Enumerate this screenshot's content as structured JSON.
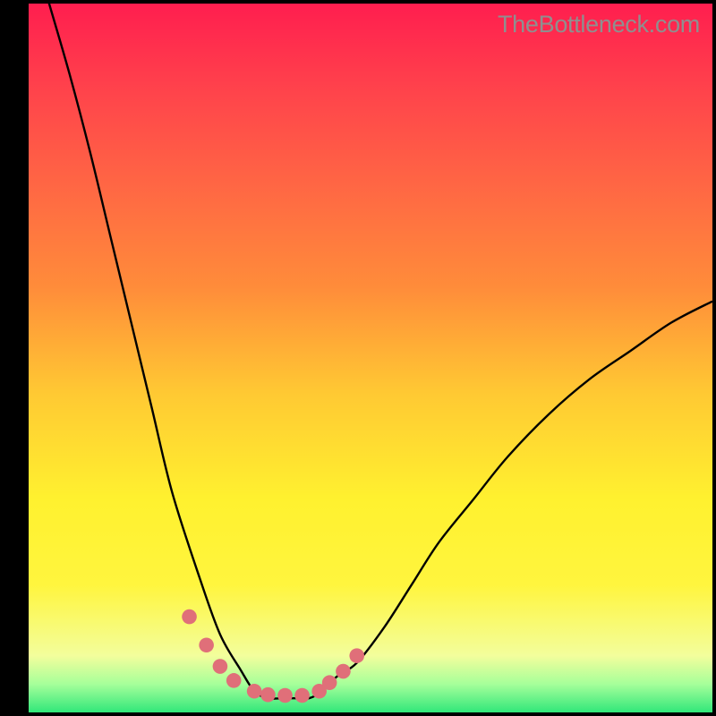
{
  "watermark": "TheBottleneck.com",
  "colors": {
    "background": "#000000",
    "gradient_top": "#ff1e4f",
    "gradient_mid_upper": "#ff8c3a",
    "gradient_mid": "#fff12f",
    "gradient_mid_lower": "#f3fe9c",
    "gradient_bottom": "#31e77a",
    "curve_stroke": "#000000",
    "marker_fill": "#e06f79",
    "watermark_text": "#8f8f8f"
  },
  "chart_data": {
    "type": "line",
    "title": "",
    "xlabel": "",
    "ylabel": "",
    "x": [
      0.0,
      0.03,
      0.06,
      0.09,
      0.12,
      0.15,
      0.18,
      0.21,
      0.25,
      0.28,
      0.31,
      0.33,
      0.35,
      0.37,
      0.39,
      0.41,
      0.43,
      0.45,
      0.48,
      0.52,
      0.56,
      0.6,
      0.65,
      0.7,
      0.76,
      0.82,
      0.88,
      0.94,
      1.0
    ],
    "y": [
      1.1,
      1.0,
      0.9,
      0.79,
      0.67,
      0.55,
      0.43,
      0.31,
      0.19,
      0.11,
      0.06,
      0.03,
      0.02,
      0.02,
      0.02,
      0.02,
      0.03,
      0.05,
      0.07,
      0.12,
      0.18,
      0.24,
      0.3,
      0.36,
      0.42,
      0.47,
      0.51,
      0.55,
      0.58
    ],
    "xlim": [
      0,
      1
    ],
    "ylim": [
      0,
      1
    ],
    "markers": {
      "x": [
        0.235,
        0.26,
        0.28,
        0.3,
        0.33,
        0.35,
        0.375,
        0.4,
        0.425,
        0.44,
        0.46,
        0.48
      ],
      "y": [
        0.135,
        0.095,
        0.065,
        0.045,
        0.03,
        0.025,
        0.024,
        0.024,
        0.03,
        0.042,
        0.058,
        0.08
      ]
    }
  }
}
